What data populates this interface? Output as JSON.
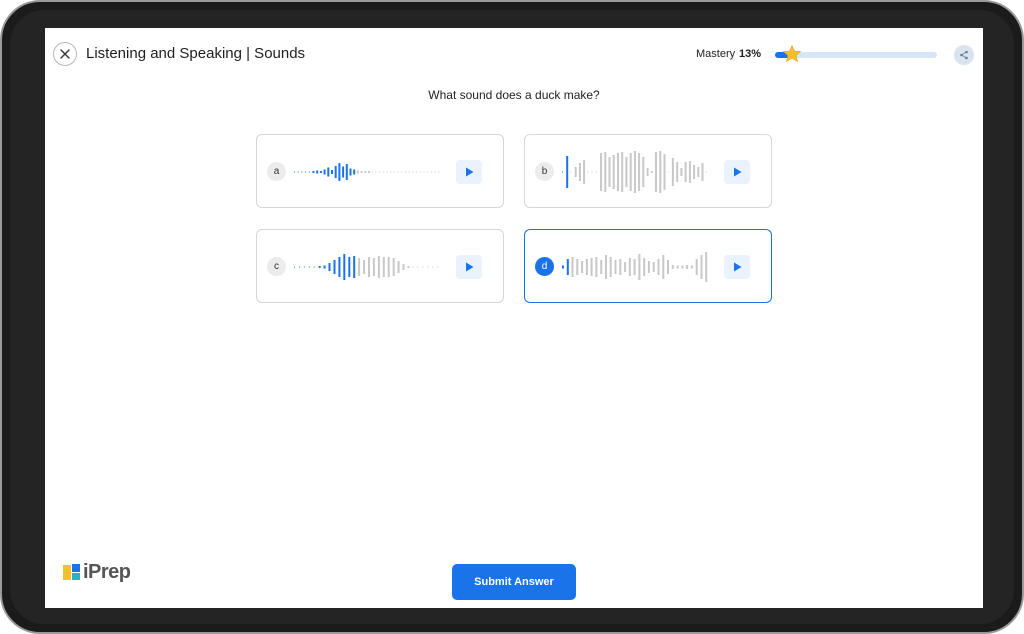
{
  "header": {
    "title": "Listening and Speaking | Sounds",
    "mastery_label": "Mastery",
    "mastery_value": "13%",
    "mastery_progress": 0.13
  },
  "question": "What sound does a duck make?",
  "options": [
    {
      "letter": "a",
      "selected": false
    },
    {
      "letter": "b",
      "selected": false
    },
    {
      "letter": "c",
      "selected": false
    },
    {
      "letter": "d",
      "selected": true
    }
  ],
  "icons": {
    "close": "close-icon",
    "star": "star-icon",
    "share": "share-icon",
    "play": "play-icon"
  },
  "colors": {
    "accent": "#1a73e8",
    "wave_played": "#1a73e8",
    "wave_unplayed": "#c8c8c8",
    "star": "#f6c02d"
  },
  "logo": {
    "text": "iPrep"
  },
  "submit_label": "Submit Answer"
}
